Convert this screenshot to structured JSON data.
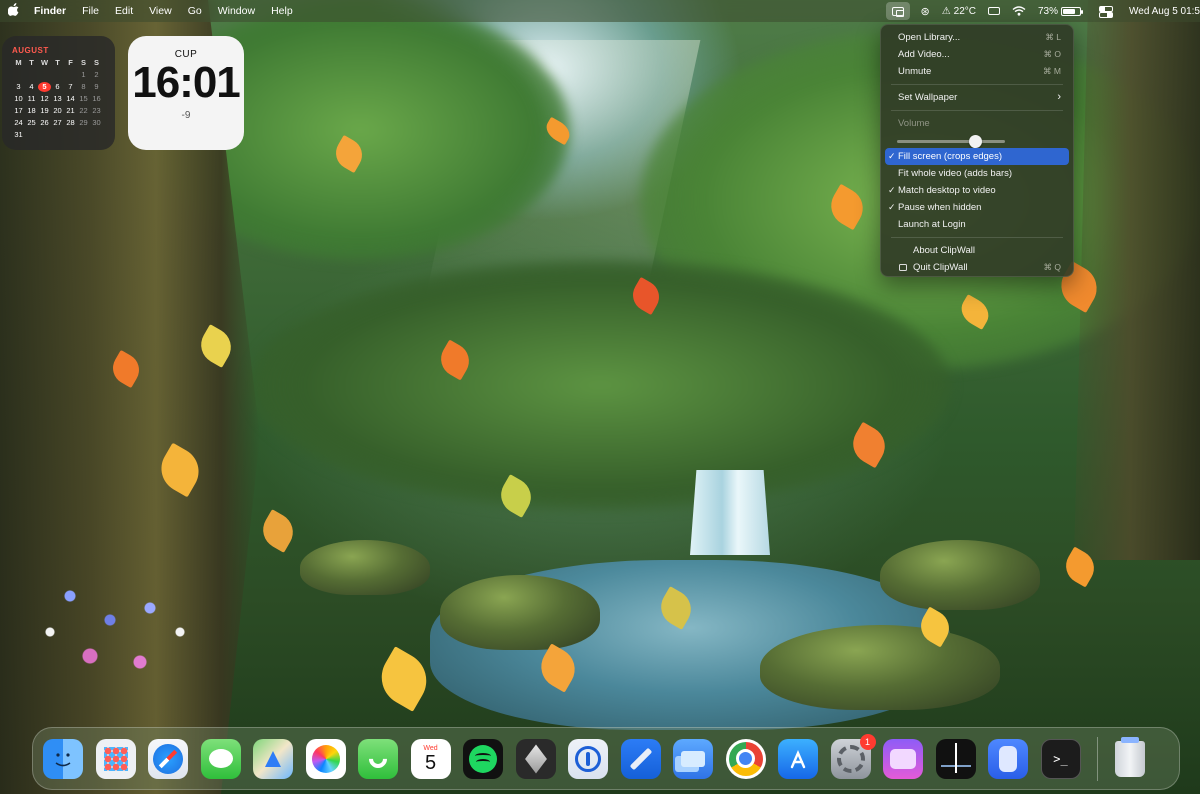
{
  "menubar": {
    "app_name": "Finder",
    "menus": [
      "File",
      "Edit",
      "View",
      "Go",
      "Window",
      "Help"
    ],
    "weather": "22°C",
    "battery_percent": "73%",
    "battery_level": 0.73,
    "datetime": "Wed Aug 5 01:5"
  },
  "calendar_widget": {
    "month": "AUGUST",
    "weekday_headers": [
      "M",
      "T",
      "W",
      "T",
      "F",
      "S",
      "S"
    ],
    "today": 5,
    "leading_blanks": 5,
    "days_in_month": 31
  },
  "clock_widget": {
    "city": "CUP",
    "time": "16:01",
    "offset": "-9"
  },
  "dropdown": {
    "open_library": {
      "label": "Open Library...",
      "shortcut": "⌘ L"
    },
    "add_video": {
      "label": "Add Video...",
      "shortcut": "⌘ O"
    },
    "unmute": {
      "label": "Unmute",
      "shortcut": "⌘ M"
    },
    "set_wallpaper": {
      "label": "Set Wallpaper",
      "chevron": "›"
    },
    "volume": {
      "label": "Volume",
      "level": 0.72
    },
    "fill_screen": {
      "label": "Fill screen (crops edges)",
      "check": "✓"
    },
    "fit_whole": {
      "label": "Fit whole video (adds bars)"
    },
    "match_desktop": {
      "label": "Match desktop to video",
      "check": "✓"
    },
    "pause_hidden": {
      "label": "Pause when hidden",
      "check": "✓"
    },
    "launch_login": {
      "label": "Launch at Login"
    },
    "about": {
      "label": "About ClipWall"
    },
    "quit": {
      "label": "Quit ClipWall",
      "shortcut": "⌘ Q"
    }
  },
  "dock": {
    "calendar_day": "Wed",
    "calendar_date": "5",
    "settings_badge": "1",
    "terminal_prompt": ">_",
    "icons": [
      "finder-icon",
      "launchpad-icon",
      "safari-icon",
      "messages-icon",
      "maps-icon",
      "photos-icon",
      "facetime-icon",
      "calendar-icon",
      "spotify-icon",
      "cube-app-icon",
      "1password-icon",
      "xcode-icon",
      "screens-app-icon",
      "chrome-icon",
      "app-store-icon",
      "system-settings-icon",
      "purple-app-icon",
      "stocks-chart-app-icon",
      "blue-app-icon",
      "terminal-icon",
      "trash-icon"
    ]
  },
  "colors": {
    "menu_highlight": "#2f66d0",
    "calendar_today": "#ff3b30",
    "calendar_month": "#ff5a4f",
    "badge": "#ff3b30"
  }
}
